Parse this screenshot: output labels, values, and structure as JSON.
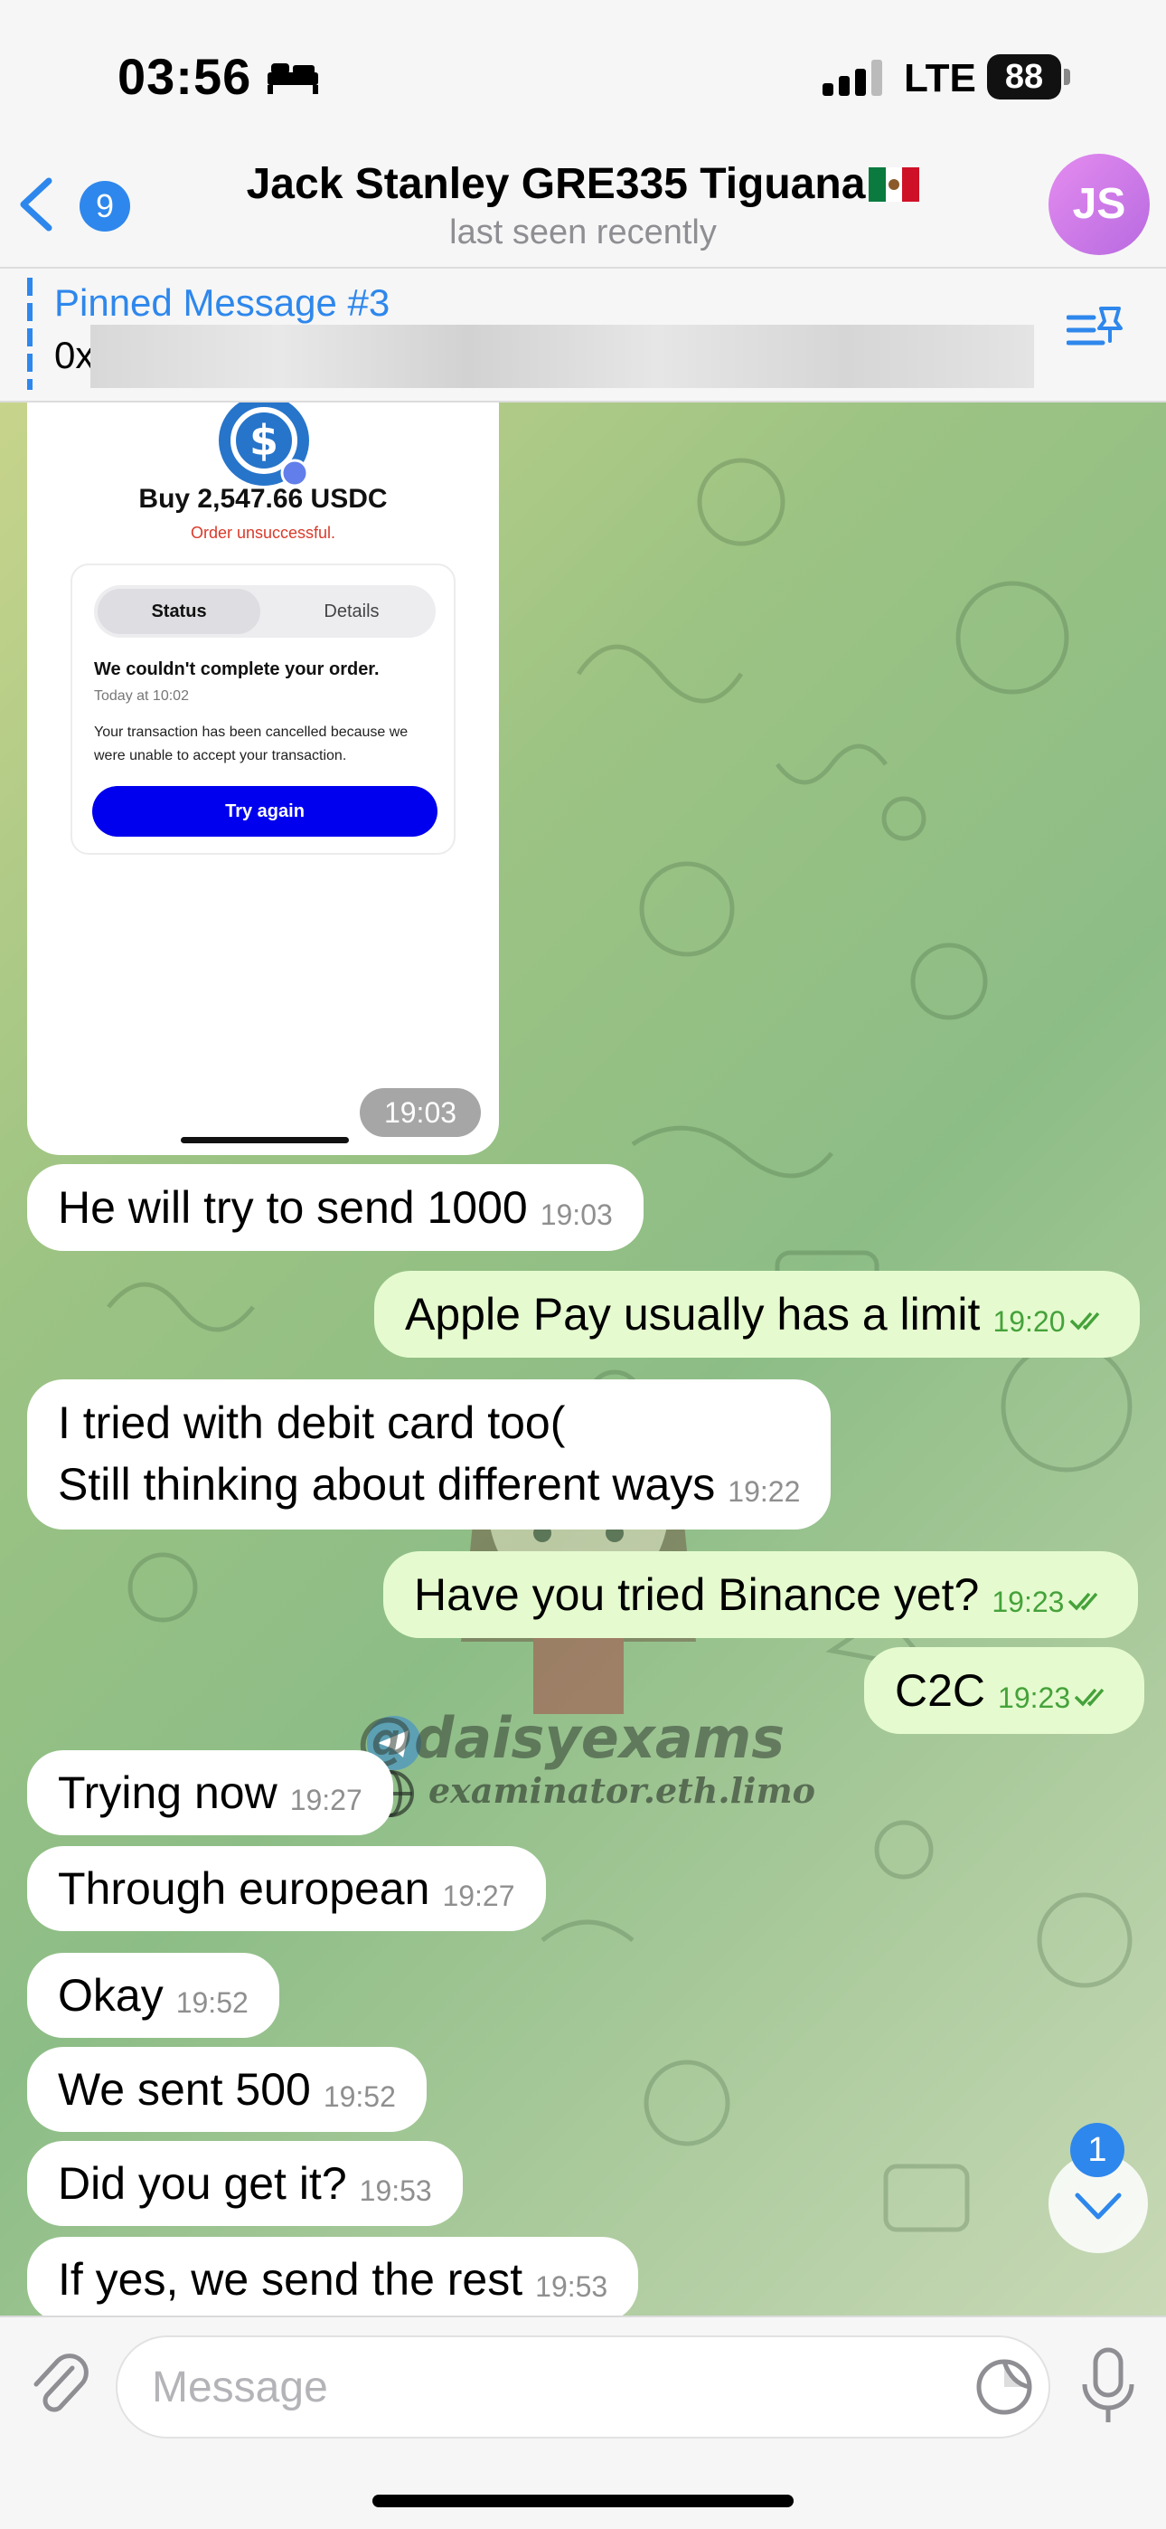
{
  "status_bar": {
    "time": "03:56",
    "network": "LTE",
    "battery": "88"
  },
  "header": {
    "back_count": "9",
    "title": "Jack Stanley GRE335 Tiguana",
    "subtitle": "last seen recently",
    "avatar_initials": "JS"
  },
  "pinned": {
    "title": "Pinned Message #3",
    "text": "0x"
  },
  "photo_message": {
    "buy_text": "Buy 2,547.66 USDC",
    "order_status": "Order unsuccessful.",
    "tab_status": "Status",
    "tab_details": "Details",
    "card_heading": "We couldn't complete your order.",
    "card_time": "Today at 10:02",
    "card_body": "Your transaction has been cancelled because we were unable to accept your transaction.",
    "button": "Try again",
    "time": "19:03"
  },
  "messages": [
    {
      "text": "He will try to send 1000",
      "time": "19:03",
      "direction": "in"
    },
    {
      "text": "Apple Pay usually has a limit",
      "time": "19:20",
      "direction": "out"
    },
    {
      "line1": "I tried with debit card too(",
      "line2": "Still thinking about different ways",
      "time": "19:22",
      "direction": "in"
    },
    {
      "text": "Have you tried Binance yet?",
      "time": "19:23",
      "direction": "out"
    },
    {
      "text": "C2C",
      "time": "19:23",
      "direction": "out"
    },
    {
      "text": "Trying now",
      "time": "19:27",
      "direction": "in"
    },
    {
      "text": "Through european",
      "time": "19:27",
      "direction": "in"
    },
    {
      "text": "Okay",
      "time": "19:52",
      "direction": "in"
    },
    {
      "text": "We sent 500",
      "time": "19:52",
      "direction": "in"
    },
    {
      "text": "Did you get it?",
      "time": "19:53",
      "direction": "in"
    },
    {
      "text": "If yes, we send the rest",
      "time": "19:53",
      "direction": "in"
    }
  ],
  "watermark": {
    "handle": "@daisyexams",
    "site": "examinator.eth.limo"
  },
  "scroll": {
    "unread": "1"
  },
  "composer": {
    "placeholder": "Message"
  },
  "colors": {
    "accent": "#2e87ec",
    "outgoing_bubble": "#e5fbcf",
    "incoming_bubble": "#ffffff",
    "check_green": "#45a23a"
  }
}
